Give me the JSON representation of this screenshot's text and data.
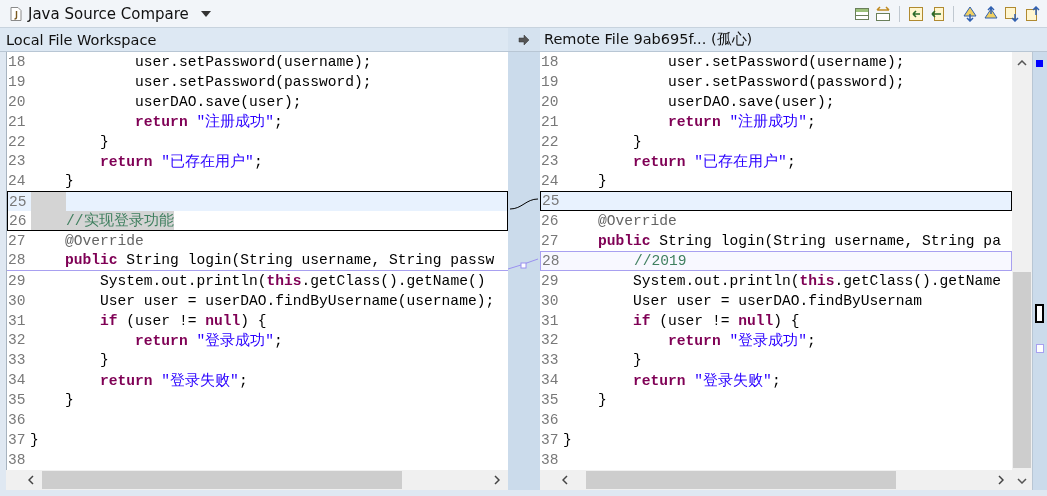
{
  "toolbar": {
    "title": "Java Source Compare"
  },
  "panes": [
    {
      "header": "Local File Workspace",
      "lines": [
        {
          "number": "18",
          "kind": "plain",
          "current": false,
          "selected": false,
          "tokens": [
            {
              "kind": "plain",
              "text": "            user.setPassword(username);"
            }
          ]
        },
        {
          "number": "19",
          "kind": "plain",
          "current": false,
          "selected": false,
          "tokens": [
            {
              "kind": "plain",
              "text": "            user.setPassword(password);"
            }
          ]
        },
        {
          "number": "20",
          "kind": "plain",
          "current": false,
          "selected": false,
          "tokens": [
            {
              "kind": "plain",
              "text": "            userDAO.save(user);"
            }
          ]
        },
        {
          "number": "21",
          "kind": "plain",
          "current": false,
          "selected": false,
          "tokens": [
            {
              "kind": "keyword",
              "text": "            return"
            },
            {
              "kind": "string",
              "text": " \"注册成功\""
            },
            {
              "kind": "plain",
              "text": ";"
            }
          ]
        },
        {
          "number": "22",
          "kind": "plain",
          "current": false,
          "selected": false,
          "tokens": [
            {
              "kind": "plain",
              "text": "        }"
            }
          ]
        },
        {
          "number": "23",
          "kind": "plain",
          "current": false,
          "selected": false,
          "tokens": [
            {
              "kind": "keyword",
              "text": "        return"
            },
            {
              "kind": "string",
              "text": " \"已存在用户\""
            },
            {
              "kind": "plain",
              "text": ";"
            }
          ]
        },
        {
          "number": "24",
          "kind": "plain",
          "current": false,
          "selected": false,
          "tokens": [
            {
              "kind": "plain",
              "text": "    }"
            }
          ]
        },
        {
          "number": "25",
          "kind": "block",
          "current": true,
          "selected": true
        },
        {
          "number": "26",
          "kind": "block",
          "current": false,
          "selected": true,
          "tokens": [
            {
              "kind": "comment",
              "text": "    //实现登录功能"
            }
          ]
        },
        {
          "number": "27",
          "kind": "plain",
          "current": false,
          "selected": false,
          "tokens": [
            {
              "kind": "annotation",
              "text": "    @Override"
            }
          ]
        },
        {
          "number": "28",
          "kind": "underline",
          "current": false,
          "selected": false,
          "tokens": [
            {
              "kind": "keyword",
              "text": "    public"
            },
            {
              "kind": "plain",
              "text": " String login(String username, String passw"
            }
          ]
        },
        {
          "number": "29",
          "kind": "plain",
          "current": false,
          "selected": false,
          "tokens": [
            {
              "kind": "plain",
              "text": "        System.out.println("
            },
            {
              "kind": "keyword",
              "text": "this"
            },
            {
              "kind": "plain",
              "text": ".getClass().getName()"
            }
          ]
        },
        {
          "number": "30",
          "kind": "plain",
          "current": false,
          "selected": false,
          "tokens": [
            {
              "kind": "plain",
              "text": "        User user = userDAO.findByUsername(username);"
            }
          ]
        },
        {
          "number": "31",
          "kind": "plain",
          "current": false,
          "selected": false,
          "tokens": [
            {
              "kind": "keyword",
              "text": "        if"
            },
            {
              "kind": "plain",
              "text": " (user != "
            },
            {
              "kind": "keyword",
              "text": "null"
            },
            {
              "kind": "plain",
              "text": ") {"
            }
          ]
        },
        {
          "number": "32",
          "kind": "plain",
          "current": false,
          "selected": false,
          "tokens": [
            {
              "kind": "keyword",
              "text": "            return"
            },
            {
              "kind": "string",
              "text": " \"登录成功\""
            },
            {
              "kind": "plain",
              "text": ";"
            }
          ]
        },
        {
          "number": "33",
          "kind": "plain",
          "current": false,
          "selected": false,
          "tokens": [
            {
              "kind": "plain",
              "text": "        }"
            }
          ]
        },
        {
          "number": "34",
          "kind": "plain",
          "current": false,
          "selected": false,
          "tokens": [
            {
              "kind": "keyword",
              "text": "        return"
            },
            {
              "kind": "string",
              "text": " \"登录失败\""
            },
            {
              "kind": "plain",
              "text": ";"
            }
          ]
        },
        {
          "number": "35",
          "kind": "plain",
          "current": false,
          "selected": false,
          "tokens": [
            {
              "kind": "plain",
              "text": "    }"
            }
          ]
        },
        {
          "number": "36",
          "kind": "plain",
          "current": false,
          "selected": false
        },
        {
          "number": "37",
          "kind": "plain",
          "current": false,
          "selected": false,
          "tokens": [
            {
              "kind": "plain",
              "text": "}"
            }
          ]
        },
        {
          "number": "38",
          "kind": "plain",
          "current": false,
          "selected": false
        }
      ]
    },
    {
      "header": "Remote File 9ab695f... (孤心)",
      "lines": [
        {
          "number": "18",
          "kind": "plain",
          "current": false,
          "selected": false,
          "tokens": [
            {
              "kind": "plain",
              "text": "            user.setPassword(username);"
            }
          ]
        },
        {
          "number": "19",
          "kind": "plain",
          "current": false,
          "selected": false,
          "tokens": [
            {
              "kind": "plain",
              "text": "            user.setPassword(password);"
            }
          ]
        },
        {
          "number": "20",
          "kind": "plain",
          "current": false,
          "selected": false,
          "tokens": [
            {
              "kind": "plain",
              "text": "            userDAO.save(user);"
            }
          ]
        },
        {
          "number": "21",
          "kind": "plain",
          "current": false,
          "selected": false,
          "tokens": [
            {
              "kind": "keyword",
              "text": "            return"
            },
            {
              "kind": "string",
              "text": " \"注册成功\""
            },
            {
              "kind": "plain",
              "text": ";"
            }
          ]
        },
        {
          "number": "22",
          "kind": "plain",
          "current": false,
          "selected": false,
          "tokens": [
            {
              "kind": "plain",
              "text": "        }"
            }
          ]
        },
        {
          "number": "23",
          "kind": "plain",
          "current": false,
          "selected": false,
          "tokens": [
            {
              "kind": "keyword",
              "text": "        return"
            },
            {
              "kind": "string",
              "text": " \"已存在用户\""
            },
            {
              "kind": "plain",
              "text": ";"
            }
          ]
        },
        {
          "number": "24",
          "kind": "plain",
          "current": false,
          "selected": false,
          "tokens": [
            {
              "kind": "plain",
              "text": "    }"
            }
          ]
        },
        {
          "number": "25",
          "kind": "block",
          "current": true,
          "selected": false
        },
        {
          "number": "26",
          "kind": "plain",
          "current": false,
          "selected": false,
          "tokens": [
            {
              "kind": "annotation",
              "text": "    @Override"
            }
          ]
        },
        {
          "number": "27",
          "kind": "plain",
          "current": false,
          "selected": false,
          "tokens": [
            {
              "kind": "keyword",
              "text": "    public"
            },
            {
              "kind": "plain",
              "text": " String login(String username, String pa"
            }
          ]
        },
        {
          "number": "28",
          "kind": "light",
          "current": false,
          "selected": false,
          "tokens": [
            {
              "kind": "comment",
              "text": "        //2019"
            }
          ]
        },
        {
          "number": "29",
          "kind": "plain",
          "current": false,
          "selected": false,
          "tokens": [
            {
              "kind": "plain",
              "text": "        System.out.println("
            },
            {
              "kind": "keyword",
              "text": "this"
            },
            {
              "kind": "plain",
              "text": ".getClass().getName"
            }
          ]
        },
        {
          "number": "30",
          "kind": "plain",
          "current": false,
          "selected": false,
          "tokens": [
            {
              "kind": "plain",
              "text": "        User user = userDAO.findByUsernam"
            }
          ]
        },
        {
          "number": "31",
          "kind": "plain",
          "current": false,
          "selected": false,
          "tokens": [
            {
              "kind": "keyword",
              "text": "        if"
            },
            {
              "kind": "plain",
              "text": " (user != "
            },
            {
              "kind": "keyword",
              "text": "null"
            },
            {
              "kind": "plain",
              "text": ") {"
            }
          ]
        },
        {
          "number": "32",
          "kind": "plain",
          "current": false,
          "selected": false,
          "tokens": [
            {
              "kind": "keyword",
              "text": "            return"
            },
            {
              "kind": "string",
              "text": " \"登录成功\""
            },
            {
              "kind": "plain",
              "text": ";"
            }
          ]
        },
        {
          "number": "33",
          "kind": "plain",
          "current": false,
          "selected": false,
          "tokens": [
            {
              "kind": "plain",
              "text": "        }"
            }
          ]
        },
        {
          "number": "34",
          "kind": "plain",
          "current": false,
          "selected": false,
          "tokens": [
            {
              "kind": "keyword",
              "text": "        return"
            },
            {
              "kind": "string",
              "text": " \"登录失败\""
            },
            {
              "kind": "plain",
              "text": ";"
            }
          ]
        },
        {
          "number": "35",
          "kind": "plain",
          "current": false,
          "selected": false,
          "tokens": [
            {
              "kind": "plain",
              "text": "    }"
            }
          ]
        },
        {
          "number": "36",
          "kind": "plain",
          "current": false,
          "selected": false
        },
        {
          "number": "37",
          "kind": "plain",
          "current": false,
          "selected": false,
          "tokens": [
            {
              "kind": "plain",
              "text": "}"
            }
          ]
        },
        {
          "number": "38",
          "kind": "plain",
          "current": false,
          "selected": false
        }
      ]
    }
  ]
}
